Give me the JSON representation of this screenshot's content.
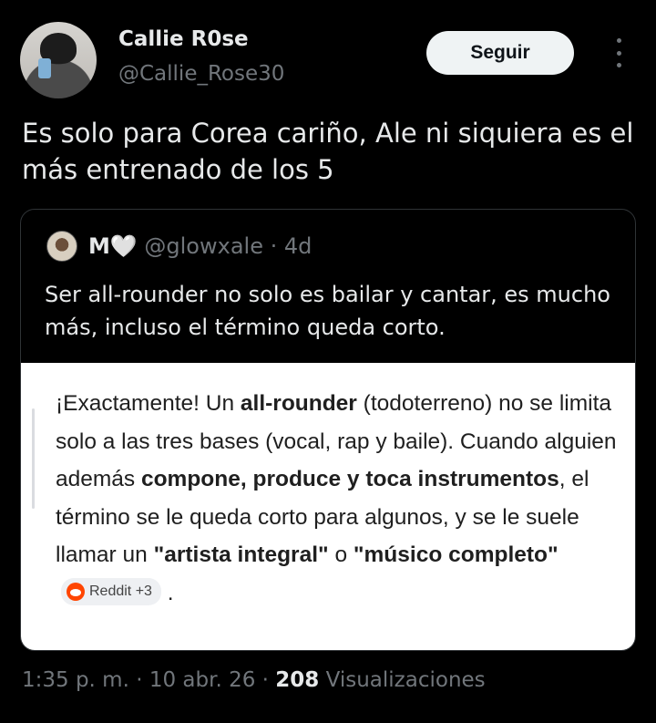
{
  "author": {
    "name": "Callie R0se",
    "handle": "@Callie_Rose30",
    "follow_label": "Seguir"
  },
  "tweet": {
    "text": "Es solo para Corea cariño, Ale ni siquiera es el más entrenado de los 5"
  },
  "quote": {
    "name": "M🤍",
    "handle": "@glowxale",
    "separator": "·",
    "age": "4d",
    "text": "Ser all-rounder no solo es bailar y cantar, es mucho más, incluso el término queda corto.",
    "card": {
      "t1": "¡Exactamente! Un ",
      "b1": "all-rounder",
      "t2": " (todoterreno) no se limita solo a las tres bases (vocal, rap y baile). Cuando alguien además ",
      "b2": "compone, produce y toca instrumentos",
      "t3": ", el término se le queda corto para algunos, y se le suele llamar un ",
      "b3": "\"artista integral\"",
      "t4": " o ",
      "b4": "\"músico completo\"",
      "chip_label": "Reddit +3",
      "t5": " ."
    }
  },
  "meta": {
    "time": "1:35 p. m.",
    "sep1": "·",
    "date": "10 abr. 26",
    "sep2": "·",
    "views_count": "208",
    "views_label": "Visualizaciones"
  }
}
